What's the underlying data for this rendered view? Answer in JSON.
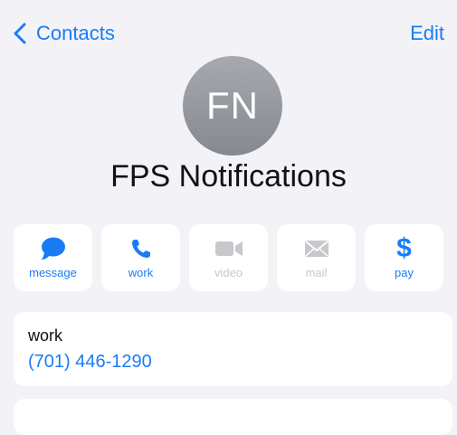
{
  "nav": {
    "back_label": "Contacts",
    "edit_label": "Edit"
  },
  "contact": {
    "initials": "FN",
    "name": "FPS Notifications"
  },
  "actions": [
    {
      "label": "message",
      "icon": "message-bubble-icon",
      "enabled": true
    },
    {
      "label": "work",
      "icon": "phone-icon",
      "enabled": true
    },
    {
      "label": "video",
      "icon": "video-camera-icon",
      "enabled": false
    },
    {
      "label": "mail",
      "icon": "envelope-icon",
      "enabled": false
    },
    {
      "label": "pay",
      "icon": "dollar-icon",
      "enabled": true
    }
  ],
  "phone": {
    "type": "work",
    "number": "(701) 446-1290"
  },
  "colors": {
    "accent": "#1a7cf5",
    "disabled": "#c8c8cc",
    "background": "#f2f2f7"
  }
}
